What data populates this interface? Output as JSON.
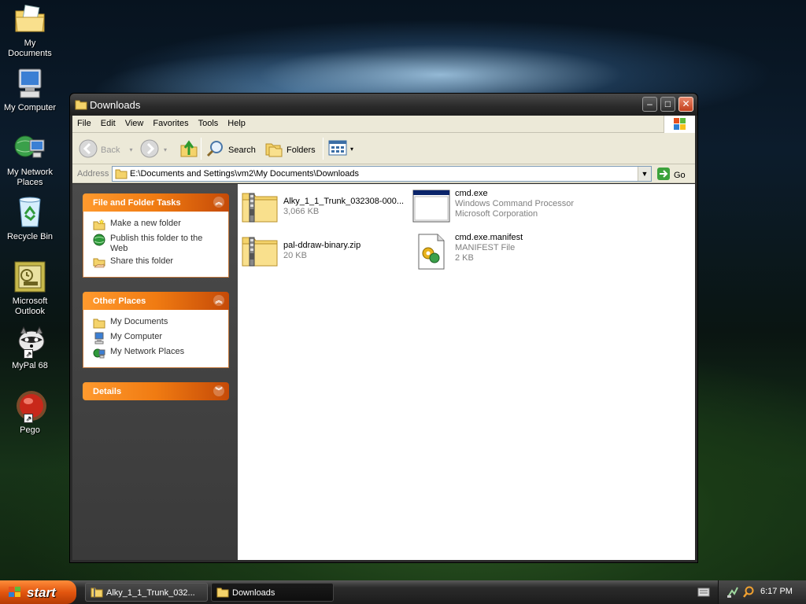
{
  "desktop": {
    "icons": [
      {
        "label": "My Documents"
      },
      {
        "label": "My Computer"
      },
      {
        "label": "My Network Places"
      },
      {
        "label": "Recycle Bin"
      },
      {
        "label": "Microsoft Outlook"
      },
      {
        "label": "MyPal 68"
      },
      {
        "label": "Pego"
      }
    ]
  },
  "window": {
    "title": "Downloads",
    "menu": [
      "File",
      "Edit",
      "View",
      "Favorites",
      "Tools",
      "Help"
    ],
    "toolbar": {
      "back": "Back",
      "search": "Search",
      "folders": "Folders"
    },
    "address": {
      "label": "Address",
      "value": "E:\\Documents and Settings\\vm2\\My Documents\\Downloads",
      "go": "Go"
    },
    "tasks_panel": {
      "title": "File and Folder Tasks",
      "items": [
        "Make a new folder",
        "Publish this folder to the Web",
        "Share this folder"
      ]
    },
    "other_places": {
      "title": "Other Places",
      "items": [
        "My Documents",
        "My Computer",
        "My Network Places"
      ]
    },
    "details_panel": {
      "title": "Details"
    },
    "files": [
      {
        "name": "Alky_1_1_Trunk_032308-000...",
        "line2": "3,066 KB",
        "line3": "",
        "icon": "zip-folder-icon"
      },
      {
        "name": "cmd.exe",
        "line2": "Windows Command Processor",
        "line3": "Microsoft Corporation",
        "icon": "console-window-icon"
      },
      {
        "name": "pal-ddraw-binary.zip",
        "line2": "20 KB",
        "line3": "",
        "icon": "zip-folder-icon"
      },
      {
        "name": "cmd.exe.manifest",
        "line2": "MANIFEST File",
        "line3": "2 KB",
        "icon": "manifest-file-icon"
      }
    ]
  },
  "taskbar": {
    "start": "start",
    "buttons": [
      "Alky_1_1_Trunk_032...",
      "Downloads"
    ],
    "clock": "6:17 PM"
  }
}
